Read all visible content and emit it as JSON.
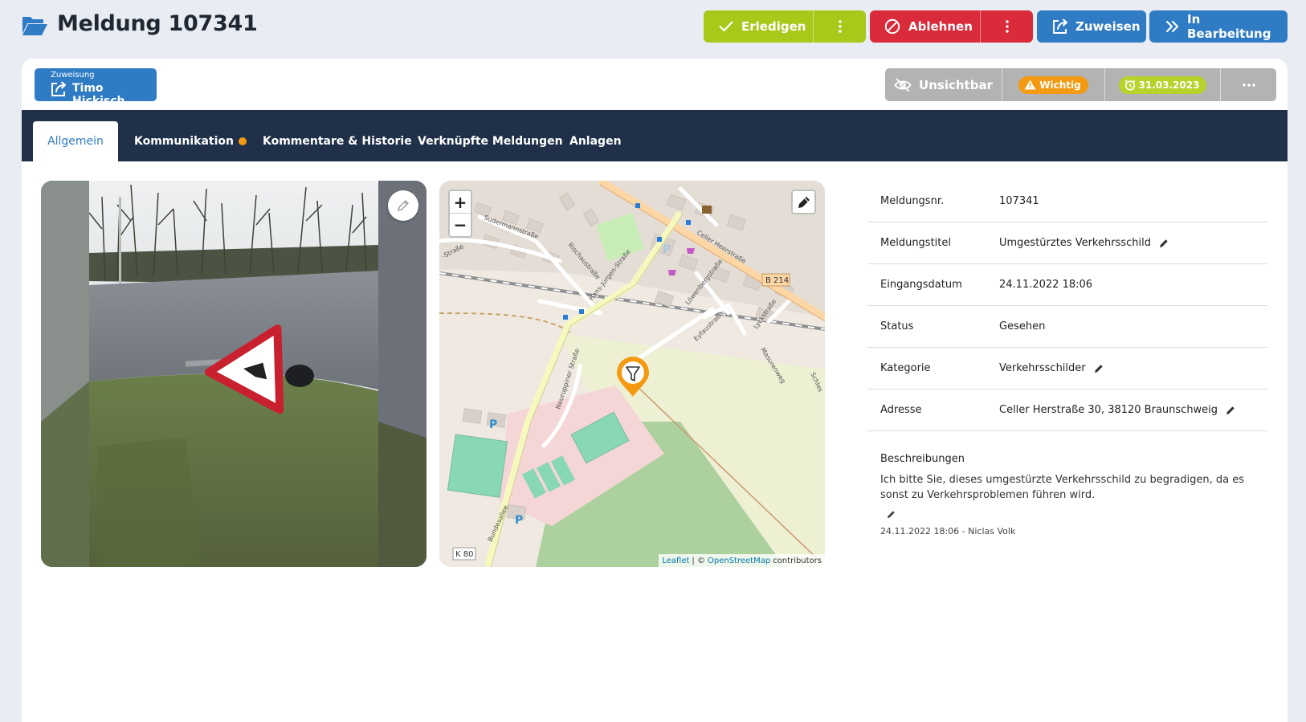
{
  "header": {
    "title": "Meldung 107341"
  },
  "actions": {
    "erledigen": "Erledigen",
    "ablehnen": "Ablehnen",
    "zuweisen": "Zuweisen",
    "in_bearbeitung": "In Bearbeitung"
  },
  "assignment": {
    "caption": "Zuweisung",
    "name": "Timo Hickisch"
  },
  "flags": {
    "visibility": "Unsichtbar",
    "priority": "Wichtig",
    "due_date": "31.03.2023"
  },
  "tabs": [
    {
      "label": "Allgemein",
      "active": true
    },
    {
      "label": "Kommunikation",
      "has_notification": true
    },
    {
      "label": "Kommentare & Historie"
    },
    {
      "label": "Verknüpfte Meldungen"
    },
    {
      "label": "Anlagen"
    }
  ],
  "map": {
    "streets": [
      "Hans-Jürgen-Straße",
      "Celler Heerstraße",
      "Sudermannstraße",
      "Rischaustraße",
      "Löwenbergstraße",
      "Eyfaustraße",
      "Lyckstraße",
      "Masurenweg",
      "Neuruppiner Straße",
      "Bundesallee",
      "-Straße",
      "Schles"
    ],
    "road_refs": [
      "B 214",
      "K 80"
    ],
    "attribution": {
      "leaflet": "Leaflet",
      "separator": "| ©",
      "osm": "OpenStreetMap",
      "suffix": "contributors"
    }
  },
  "details": {
    "rows": [
      {
        "label": "Meldungsnr.",
        "value": "107341"
      },
      {
        "label": "Meldungstitel",
        "value": "Umgestürztes Verkehrsschild"
      },
      {
        "label": "Eingangsdatum",
        "value": "24.11.2022 18:06"
      },
      {
        "label": "Status",
        "value": "Gesehen"
      },
      {
        "label": "Kategorie",
        "value": "Verkehrsschilder"
      },
      {
        "label": "Adresse",
        "value": "Celler Herstraße 30, 38120 Braunschweig"
      }
    ],
    "description_label": "Beschreibungen",
    "description_text": "Ich bitte Sie, dieses umgestürzte Verkehrsschild zu begradigen, da es sonst zu Verkehrsproblemen führen wird.",
    "description_meta": "24.11.2022 18:06 - Niclas Volk"
  },
  "colors": {
    "success": "#a8c81a",
    "danger": "#d92b3a",
    "primary": "#2f7cc4",
    "nav": "#1f3048",
    "warning": "#f39a12",
    "date_badge": "#b5d32a",
    "flag_bg": "#b3b3b3"
  },
  "icons": [
    "folder-open-icon",
    "check-icon",
    "vertical-dots-icon",
    "ban-icon",
    "share-icon",
    "double-chevron-icon",
    "eye-slash-icon",
    "warning-icon",
    "alarm-clock-icon",
    "horizontal-dots-icon",
    "pencil-icon",
    "map-marker-icon"
  ]
}
